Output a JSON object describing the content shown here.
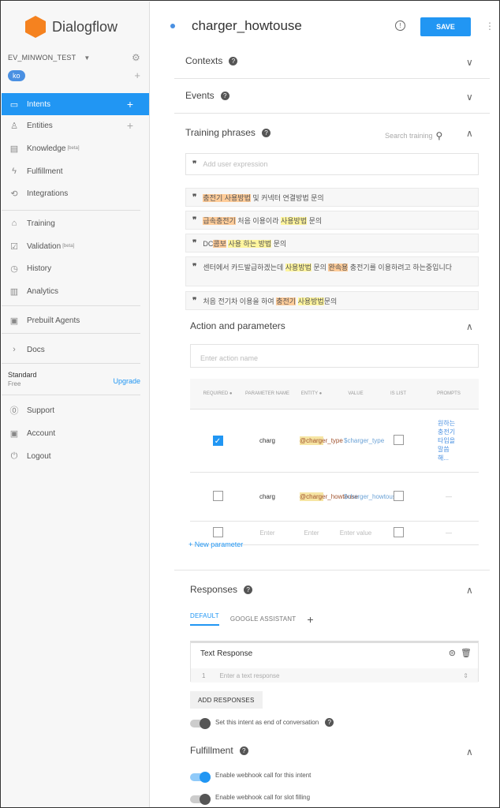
{
  "sidebar": {
    "logo_text": "Dialogflow",
    "agent_name": "EV_MINWON_TEST",
    "language": "ko",
    "nav": [
      {
        "label": "Intents",
        "icon": "chat-icon",
        "active": true
      },
      {
        "label": "Entities",
        "icon": "entities-icon"
      },
      {
        "label": "Knowledge",
        "icon": "knowledge-icon",
        "badge": "[beta]"
      },
      {
        "label": "Fulfillment",
        "icon": "bolt-icon"
      },
      {
        "label": "Integrations",
        "icon": "integrations-icon"
      },
      {
        "label": "Training",
        "icon": "graduation-icon"
      },
      {
        "label": "Validation",
        "icon": "check-icon",
        "badge": "[beta]"
      },
      {
        "label": "History",
        "icon": "clock-icon"
      },
      {
        "label": "Analytics",
        "icon": "chart-icon"
      },
      {
        "label": "Prebuilt Agents",
        "icon": "prebuilt-icon"
      },
      {
        "label": "Docs",
        "icon": "chevron-right-icon"
      },
      {
        "label": "Support",
        "icon": "help-circle-icon"
      },
      {
        "label": "Account",
        "icon": "account-icon"
      },
      {
        "label": "Logout",
        "icon": "power-icon"
      }
    ],
    "plan_name": "Standard",
    "plan_tier": "Free",
    "upgrade_label": "Upgrade"
  },
  "header": {
    "intent_name": "charger_howtouse",
    "save_label": "SAVE"
  },
  "sections": {
    "contexts": "Contexts",
    "events": "Events",
    "training": "Training phrases",
    "training_search_placeholder": "Search training",
    "action": "Action and parameters",
    "action_placeholder": "Enter action name",
    "responses": "Responses",
    "fulfillment": "Fulfillment"
  },
  "training": {
    "add_placeholder": "Add user expression",
    "phrases": [
      [
        {
          "t": "충전기 사용방법",
          "h": "orange"
        },
        {
          "t": " 및 커넥터 연결방법 문의"
        }
      ],
      [
        {
          "t": "급속충전기",
          "h": "orange"
        },
        {
          "t": " 처음 이용이라 "
        },
        {
          "t": "사용방법",
          "h": "yellow"
        },
        {
          "t": " 문의"
        }
      ],
      [
        {
          "t": "DC"
        },
        {
          "t": "콤보",
          "h": "orange"
        },
        {
          "t": " "
        },
        {
          "t": "사용 하는 방법",
          "h": "yellow"
        },
        {
          "t": " 문의"
        }
      ],
      [
        {
          "t": "센터에서 카드발급하겠는데 "
        },
        {
          "t": "사용방법",
          "h": "yellow"
        },
        {
          "t": " 문의 "
        },
        {
          "t": "완속용",
          "h": "orange"
        },
        {
          "t": " 충전기를 이용하려고 하는중입니다"
        }
      ],
      [
        {
          "t": "처음 전기차 이용을 하여 "
        },
        {
          "t": "충전기",
          "h": "orange"
        },
        {
          "t": " "
        },
        {
          "t": "사용방법",
          "h": "yellow"
        },
        {
          "t": "문의"
        }
      ]
    ]
  },
  "params": {
    "headers": [
      "REQUIRED",
      "PARAMETER NAME",
      "ENTITY",
      "VALUE",
      "IS LIST",
      "PROMPTS"
    ],
    "rows": [
      {
        "required": true,
        "name": "charg",
        "entity": "@charger_type",
        "value": "$charger_type",
        "is_list": false,
        "prompts": "원하는 충전기 타입을 말씀해..."
      },
      {
        "required": false,
        "name": "charg",
        "entity": "@charger_howtouse",
        "value": "$charger_howtouse",
        "is_list": false,
        "prompts": "—"
      },
      {
        "required": false,
        "name": "Enter",
        "entity": "Enter",
        "value": "Enter value",
        "is_list": false,
        "prompts": "—"
      }
    ],
    "new_param_label": "+ New parameter"
  },
  "responses": {
    "tabs": [
      "DEFAULT",
      "GOOGLE ASSISTANT"
    ],
    "text_response_title": "Text Response",
    "row_number": "1",
    "text_placeholder": "Enter a text response",
    "add_label": "ADD RESPONSES",
    "end_conversation_label": "Set this intent as end of conversation"
  },
  "fulfillment": {
    "webhook_label": "Enable webhook call for this intent",
    "webhook_on": true,
    "slot_label": "Enable webhook call for slot filling",
    "slot_on": false
  },
  "colors": {
    "accent": "#2196f3",
    "logo": "#f5821f",
    "entity_orange": "#ffcc99",
    "entity_yellow": "#fff59d"
  }
}
